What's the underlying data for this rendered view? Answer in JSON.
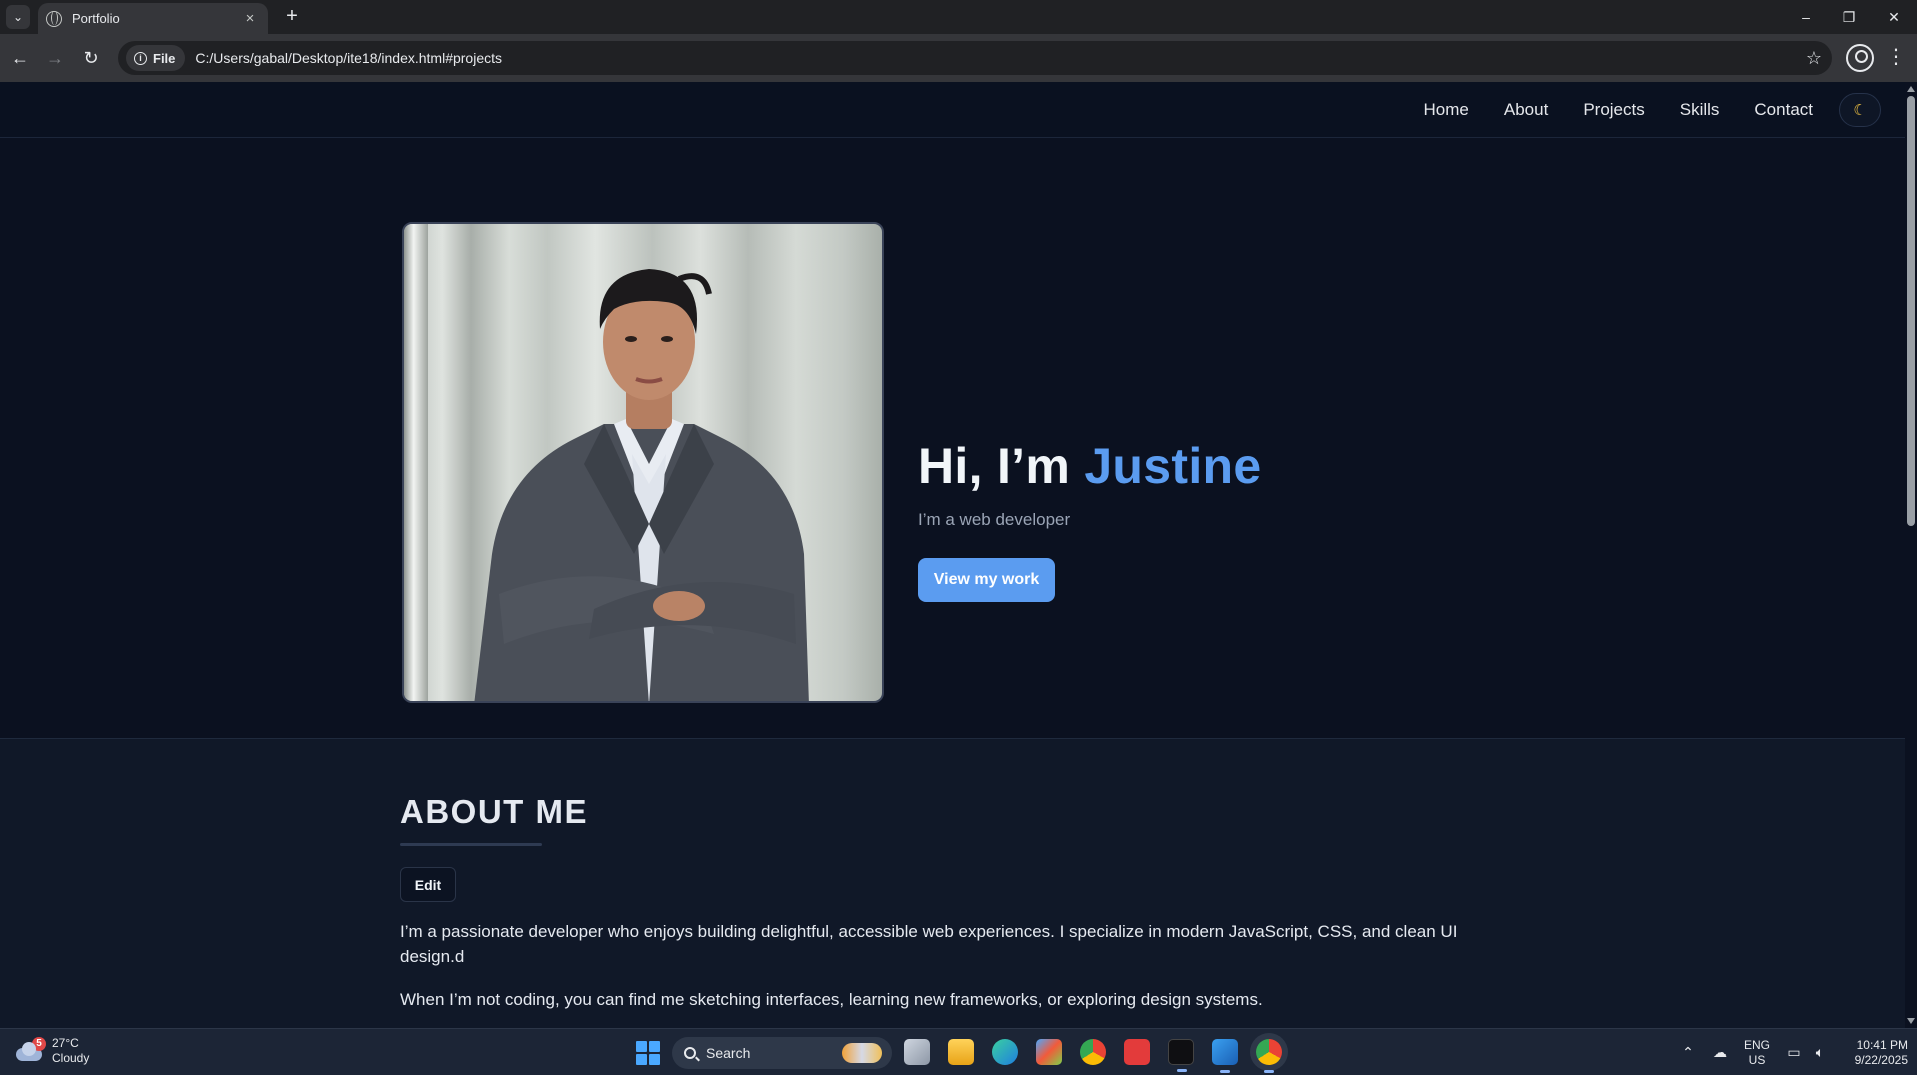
{
  "browser": {
    "tab_title": "Portfolio",
    "tab_close": "×",
    "new_tab": "+",
    "url_chip": "File",
    "url": "C:/Users/gabal/Desktop/ite18/index.html#projects",
    "window_controls": {
      "minimize": "–",
      "restore": "❐",
      "close": "✕"
    }
  },
  "nav": {
    "links": [
      "Home",
      "About",
      "Projects",
      "Skills",
      "Contact"
    ],
    "theme_icon": "☾"
  },
  "hero": {
    "greeting": "Hi, I’m ",
    "name": "Justine",
    "subtitle": "I’m a web developer",
    "cta_label": "View my work"
  },
  "about": {
    "title": "ABOUT ME",
    "edit_label": "Edit",
    "paragraph1": "I’m a passionate developer who enjoys building delightful, accessible web experiences. I specialize in modern JavaScript, CSS, and clean UI design.d",
    "paragraph2": "When I’m not coding, you can find me sketching interfaces, learning new frameworks, or exploring design systems."
  },
  "taskbar": {
    "weather_badge": "5",
    "weather_temp": "27°C",
    "weather_desc": "Cloudy",
    "search_label": "Search",
    "lang_line1": "ENG",
    "lang_line2": "US",
    "time": "10:41 PM",
    "date": "9/22/2025"
  },
  "colors": {
    "accent": "#5b9cf0",
    "background": "#0b1120",
    "section_alt": "#101828"
  }
}
